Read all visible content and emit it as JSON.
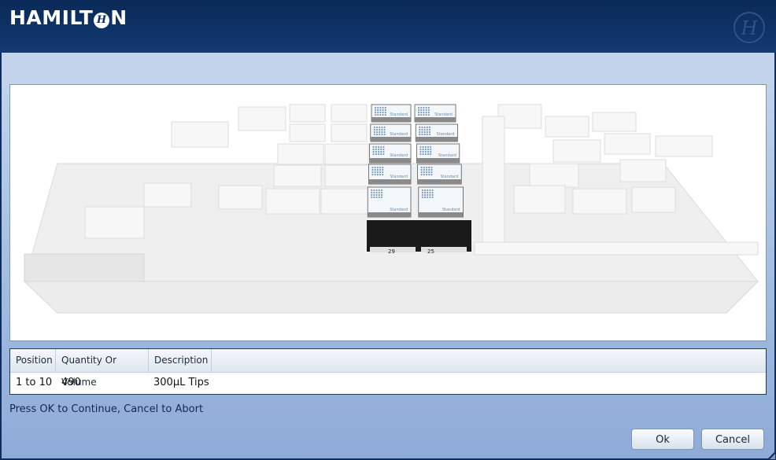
{
  "header": {
    "logo_text": "HAMILT",
    "logo_text_end": "N",
    "logo_o_glyph": "H",
    "emblem_glyph": "H"
  },
  "deck_view": {
    "carrier_labels": [
      "29",
      "25"
    ],
    "tip_label": "Standard"
  },
  "table": {
    "columns": [
      "Position",
      "Quantity Or Volume",
      "Description"
    ],
    "rows": [
      {
        "position": "1 to 10",
        "quantity": "490",
        "description": "300µL Tips"
      }
    ]
  },
  "status_text": "Press OK to Continue, Cancel to Abort",
  "buttons": {
    "ok_label": "Ok",
    "cancel_label": "Cancel"
  },
  "colors": {
    "header_bg": "#0d2d5e",
    "body_gradient_top": "#c6d6ee",
    "body_gradient_bottom": "#8eabd8",
    "highlight_tip_box": "#7b9cc0",
    "carrier_black": "#1a1a1a"
  }
}
